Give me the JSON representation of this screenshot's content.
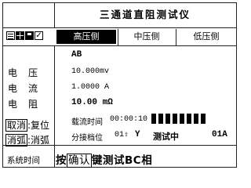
{
  "title": "三通道直阻测试仪",
  "tabs": [
    "高压侧",
    "中压侧",
    "低压侧"
  ],
  "phase": "AB",
  "rows": [
    {
      "label": "电压",
      "value": "10.000mv"
    },
    {
      "label": "电流",
      "value": "1.0000 A"
    },
    {
      "label": "电阻",
      "value": "10.00 mΩ"
    }
  ],
  "keys": {
    "cancel_key": "取消",
    "cancel_text": ":复位",
    "erase_key": "消弧",
    "erase_text": ":消弧"
  },
  "flow_time": {
    "label": "载流时间",
    "value": "00:00:10"
  },
  "tap": {
    "label": "分接档位",
    "value": "01",
    "arrow": "⇧",
    "winding": "Y",
    "status": "测试中",
    "tap_right": "01A"
  },
  "footer": {
    "left": "系统时间",
    "prefix": "按",
    "confirm_key": "确认",
    "message": "键测试BC相"
  }
}
